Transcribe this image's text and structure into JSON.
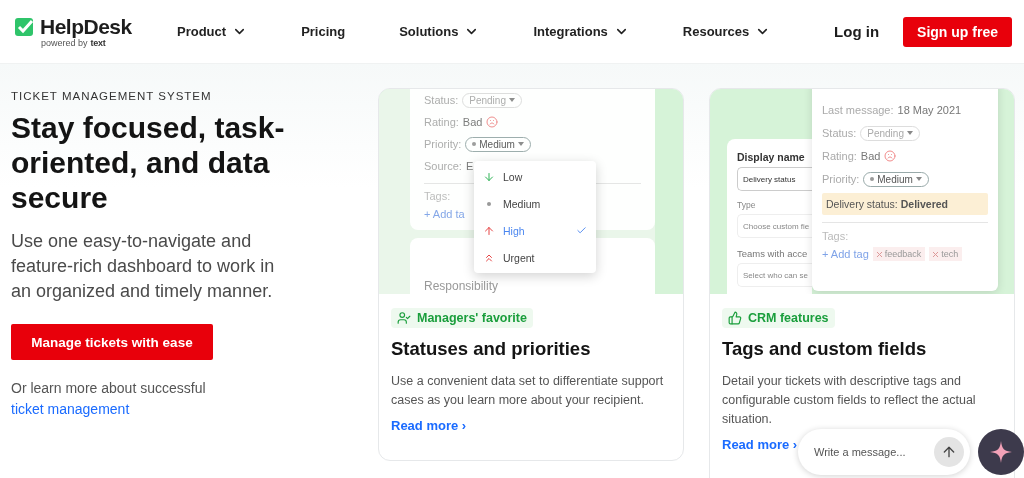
{
  "header": {
    "logo": {
      "name": "HelpDesk",
      "tagline": "powered by",
      "brand": "text"
    },
    "nav": [
      {
        "label": "Product",
        "dropdown": true
      },
      {
        "label": "Pricing",
        "dropdown": false
      },
      {
        "label": "Solutions",
        "dropdown": true
      },
      {
        "label": "Integrations",
        "dropdown": true
      },
      {
        "label": "Resources",
        "dropdown": true
      }
    ],
    "login": "Log in",
    "signup": "Sign up free"
  },
  "hero": {
    "eyebrow": "TICKET MANAGEMENT SYSTEM",
    "title": "Stay focused, task-oriented, and data secure",
    "description": "Use one easy-to-navigate and feature-rich dashboard to work in an organized and timely manner.",
    "cta": "Manage tickets with ease",
    "learn_more": "Or learn more about successful",
    "learn_more_link": "ticket management"
  },
  "cards": [
    {
      "kind": "priorities",
      "badge": {
        "kind": "user-check",
        "label": "Managers' favorite"
      },
      "title": "Statuses and priorities",
      "description": "Use a convenient data set to differentiate support cases as you learn more about your recipient.",
      "link": "Read more ›",
      "illustration": {
        "fields": [
          {
            "label": "Status:",
            "value": "Pending",
            "kind": "pill"
          },
          {
            "label": "Rating:",
            "value": "Bad",
            "kind": "rating"
          },
          {
            "label": "Priority:",
            "value": "Medium",
            "kind": "dot-pill"
          },
          {
            "label": "Source:",
            "value": "E",
            "kind": "text"
          }
        ],
        "tags_label": "Tags:",
        "add_tag": "+ Add ta",
        "section": "Responsibility",
        "menu": [
          {
            "label": "Low",
            "kind": "low",
            "selected": false
          },
          {
            "label": "Medium",
            "kind": "medium",
            "selected": false
          },
          {
            "label": "High",
            "kind": "high",
            "selected": true
          },
          {
            "label": "Urgent",
            "kind": "urgent",
            "selected": false
          }
        ]
      }
    },
    {
      "kind": "custom-fields",
      "badge": {
        "kind": "thumbs-up",
        "label": "CRM features"
      },
      "title": "Tags and custom fields",
      "description": "Detail your tickets with descriptive tags and configurable custom fields to reflect the actual situation.",
      "link": "Read more ›",
      "illustration": {
        "form": {
          "title": "Display name",
          "value": "Delivery status",
          "type_label": "Type",
          "type_placeholder": "Choose custom fie",
          "teams_label": "Teams with acce",
          "teams_placeholder": "Select who can se"
        },
        "details": {
          "fields": [
            {
              "label": "Last message:",
              "value": "18 May 2021",
              "kind": "text"
            },
            {
              "label": "Status:",
              "value": "Pending",
              "kind": "pill"
            },
            {
              "label": "Rating:",
              "value": "Bad",
              "kind": "rating"
            },
            {
              "label": "Priority:",
              "value": "Medium",
              "kind": "dot-pill"
            }
          ],
          "highlight_label": "Delivery status:",
          "highlight_value": "Delivered",
          "tags_label": "Tags:",
          "add_tag": "+ Add tag",
          "tags": [
            "feedback",
            "tech"
          ]
        }
      }
    }
  ],
  "chat": {
    "placeholder": "Write a message..."
  }
}
